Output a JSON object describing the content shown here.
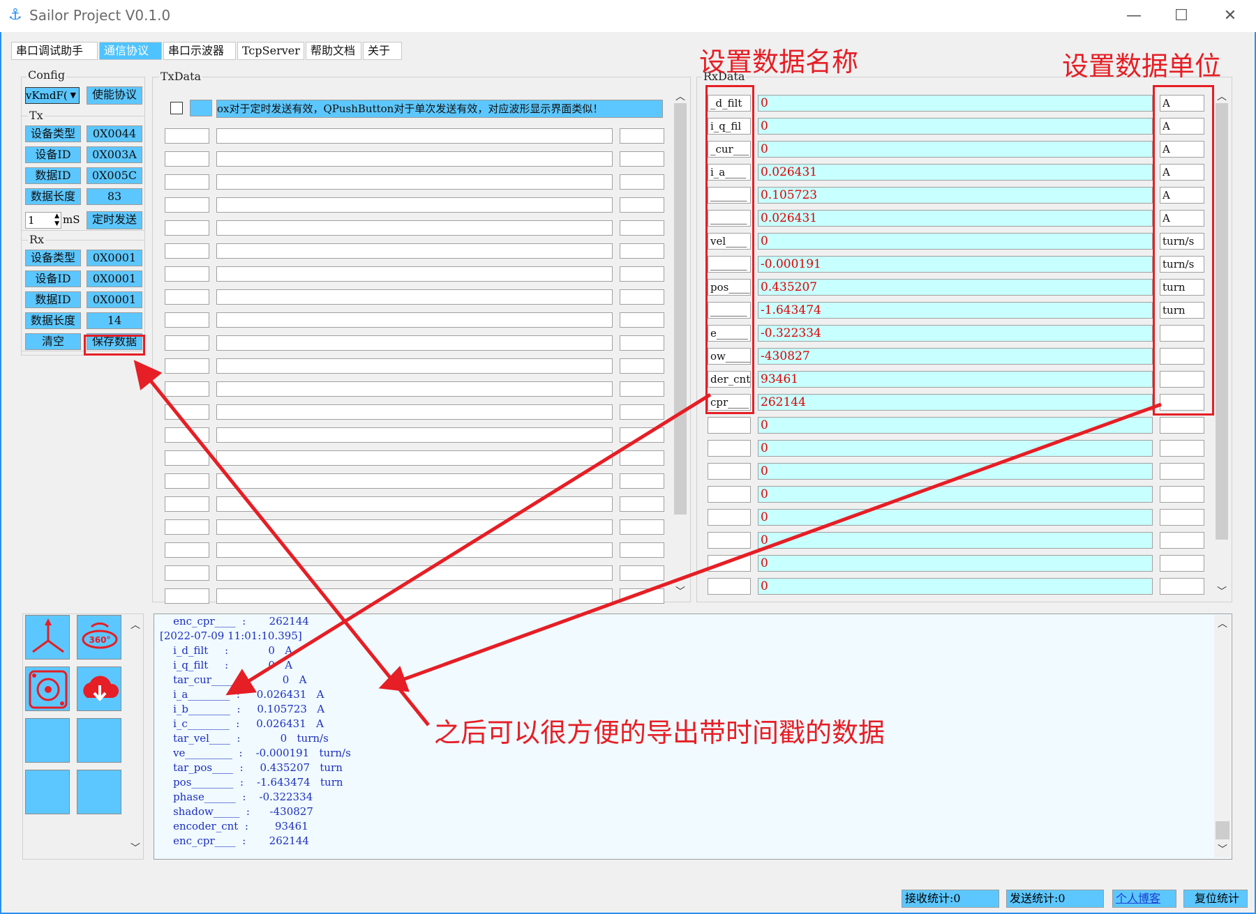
{
  "app": {
    "title": "Sailor Project V0.1.0",
    "min": "—",
    "max": "☐",
    "close": "✕"
  },
  "tabs": [
    {
      "label": "串口调试助手",
      "active": false
    },
    {
      "label": "通信协议",
      "active": true
    },
    {
      "label": "串口示波器",
      "active": false
    },
    {
      "label": "TcpServer",
      "active": false
    },
    {
      "label": "帮助文档",
      "active": false
    },
    {
      "label": "关于",
      "active": false
    }
  ],
  "config": {
    "label": "Config",
    "select_value": "vKmdF(",
    "enable_button": "使能协议"
  },
  "tx": {
    "label": "Tx",
    "rows": [
      {
        "key": "设备类型",
        "value": "0X0044"
      },
      {
        "key": "设备ID",
        "value": "0X003A"
      },
      {
        "key": "数据ID",
        "value": "0X005C"
      },
      {
        "key": "数据长度",
        "value": "83"
      }
    ],
    "interval_value": "1",
    "interval_unit": "mS",
    "timer_send": "定时发送"
  },
  "rx": {
    "label": "Rx",
    "rows": [
      {
        "key": "设备类型",
        "value": "0X0001"
      },
      {
        "key": "设备ID",
        "value": "0X0001"
      },
      {
        "key": "数据ID",
        "value": "0X0001"
      },
      {
        "key": "数据长度",
        "value": "14"
      }
    ],
    "clear": "清空",
    "save": "保存数据"
  },
  "txdata": {
    "label": "TxData",
    "first_row_text": "ox对于定时发送有效，QPushButton对于单次发送有效，对应波形显示界面类似！"
  },
  "rxdata": {
    "label": "RxData",
    "rows": [
      {
        "name": "_d_filt",
        "value": "0",
        "unit": "A"
      },
      {
        "name": "i_q_fil",
        "value": "0",
        "unit": "A"
      },
      {
        "name": "_cur___",
        "value": "0",
        "unit": "A"
      },
      {
        "name": "i_a____",
        "value": "0.026431",
        "unit": "A"
      },
      {
        "name": "_______",
        "value": "0.105723",
        "unit": "A"
      },
      {
        "name": "_______",
        "value": "0.026431",
        "unit": "A"
      },
      {
        "name": "vel____",
        "value": "0",
        "unit": "turn/s"
      },
      {
        "name": "_______",
        "value": "-0.000191",
        "unit": "turn/s"
      },
      {
        "name": "pos____",
        "value": "0.435207",
        "unit": "turn"
      },
      {
        "name": "_______",
        "value": "-1.643474",
        "unit": "turn"
      },
      {
        "name": "e______",
        "value": "-0.322334",
        "unit": ""
      },
      {
        "name": "ow_____",
        "value": "-430827",
        "unit": ""
      },
      {
        "name": "der_cnt",
        "value": "93461",
        "unit": ""
      },
      {
        "name": "cpr____",
        "value": "262144",
        "unit": ""
      },
      {
        "name": "",
        "value": "0",
        "unit": ""
      },
      {
        "name": "",
        "value": "0",
        "unit": ""
      },
      {
        "name": "",
        "value": "0",
        "unit": ""
      },
      {
        "name": "",
        "value": "0",
        "unit": ""
      },
      {
        "name": "",
        "value": "0",
        "unit": ""
      },
      {
        "name": "",
        "value": "0",
        "unit": ""
      },
      {
        "name": "",
        "value": "0",
        "unit": ""
      },
      {
        "name": "",
        "value": "0",
        "unit": ""
      }
    ]
  },
  "log": {
    "lines": [
      "    enc_cpr____  :       262144",
      "[2022-07-09 11:01:10.395]",
      "    i_d_filt     :            0   A",
      "    i_q_filt     :            0   A",
      "    tar_cur____  :            0   A",
      "    i_a________  :     0.026431   A",
      "    i_b________  :     0.105723   A",
      "    i_c________  :     0.026431   A",
      "    tar_vel____  :            0   turn/s",
      "    ve_________  :    -0.000191   turn/s",
      "    tar_pos____  :     0.435207   turn",
      "    pos________  :    -1.643474   turn",
      "    phase______  :    -0.322334",
      "    shadow_____  :      -430827",
      "    encoder_cnt  :        93461",
      "    enc_cpr____  :       262144"
    ]
  },
  "annotations": {
    "name_label": "设置数据名称",
    "unit_label": "设置数据单位",
    "export_label": "之后可以很方便的导出带时间戳的数据"
  },
  "icons": {
    "axis": "axis-icon",
    "rotate": "rotate-360-icon",
    "motor": "motor-icon",
    "download": "cloud-download-icon",
    "rotate_text": "360°"
  },
  "status": {
    "rx_count": "接收统计:0",
    "tx_count": "发送统计:0",
    "blog": "个人博客",
    "reset": "复位统计"
  },
  "colors": {
    "accent": "#2b8ff0",
    "button": "#5cc7ff",
    "rx_value_bg": "#c8ffff",
    "annotation": "#e61e25"
  }
}
